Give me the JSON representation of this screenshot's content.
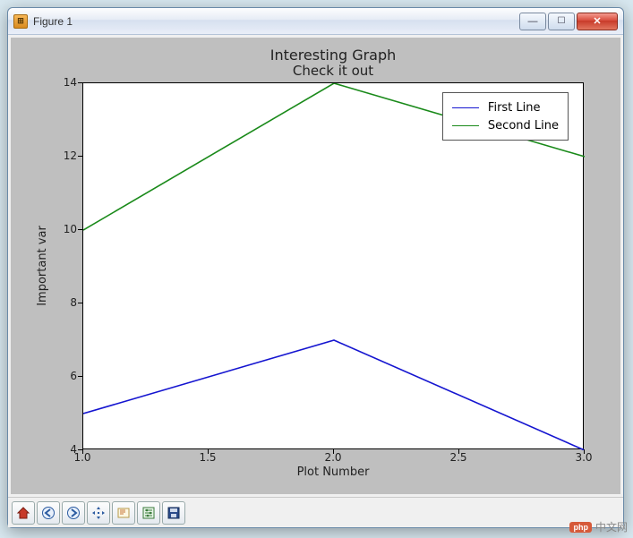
{
  "window": {
    "title": "Figure 1"
  },
  "chart_data": {
    "type": "line",
    "title": "Interesting Graph",
    "subtitle": "Check it out",
    "xlabel": "Plot Number",
    "ylabel": "Important var",
    "xticks": [
      "1.0",
      "1.5",
      "2.0",
      "2.5",
      "3.0"
    ],
    "yticks": [
      "4",
      "6",
      "8",
      "10",
      "12",
      "14"
    ],
    "xlim": [
      1.0,
      3.0
    ],
    "ylim": [
      4,
      14
    ],
    "x": [
      1,
      2,
      3
    ],
    "series": [
      {
        "name": "First Line",
        "color": "#1515d0",
        "values": [
          5,
          7,
          4
        ]
      },
      {
        "name": "Second Line",
        "color": "#1a8a1a",
        "values": [
          10,
          14,
          12
        ]
      }
    ],
    "legend_position": "upper right"
  },
  "toolbar": {
    "home": "Home",
    "back": "Back",
    "forward": "Forward",
    "pan": "Pan",
    "zoom": "Zoom",
    "subplots": "Configure subplots",
    "save": "Save"
  },
  "watermark": {
    "badge": "php",
    "text": "中文网"
  }
}
